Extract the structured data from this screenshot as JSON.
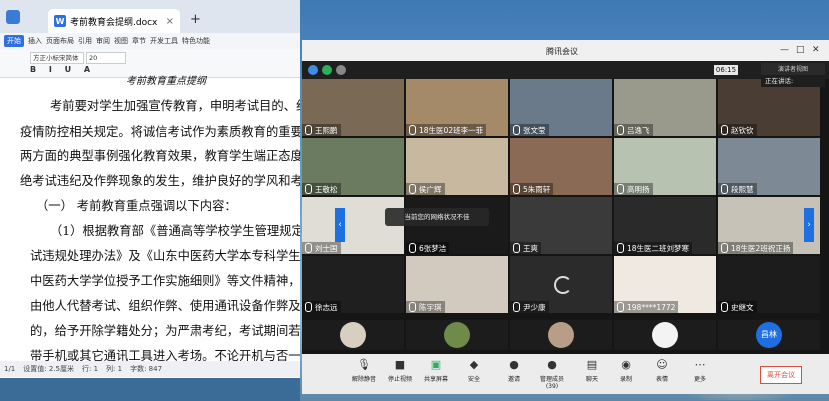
{
  "word": {
    "tab_title": "考前教育会提纲.docx",
    "doc_badge": "W",
    "plus": "+",
    "menu": [
      "开始",
      "插入",
      "页面布局",
      "引用",
      "审阅",
      "视图",
      "章节",
      "开发工具",
      "特色功能"
    ],
    "font_name": "方正小标宋简体",
    "font_size": "20",
    "format_glyphs": "B I U A",
    "lines": [
      "考前教育重点提纲",
      "考前要对学生加强宣传教育，申明考试目的、纪律和",
      "疫情防控相关规定。将诚信考试作为素质教育的重要内容",
      "两方面的典型事例强化教育效果，教育学生端正态度，诚",
      "绝考试违纪及作弊现象的发生，维护良好的学风和考风。",
      "（一） 考前教育重点强调以下内容：",
      "（1）根据教育部《普通高等学校学生管理规定》",
      "试违规处理办法》及《山东中医药大学本专科学生管理规",
      "中医药大学学位授予工作实施细则》等文件精神，对替他",
      "由他人代替考试、组织作弊、使用通讯设备作弊及其它作",
      "的，给予开除学籍处分；为严肃考纪，考试期间若发现",
      "带手机或其它通讯工具进入考场。不论开机与否一律按照"
    ],
    "status": [
      "1/1",
      "设置值: 2.5厘米",
      "行: 1",
      "列: 1",
      "字数: 847"
    ]
  },
  "meeting": {
    "title": "腾讯会议",
    "time": "06:15",
    "speaker_view": "演讲者视图",
    "speaking": "正在讲话:",
    "network_toast": "当前您的网络状况不佳",
    "participants": [
      {
        "name": "王熙鹏"
      },
      {
        "name": "18生医02班李一菲"
      },
      {
        "name": "张文莹"
      },
      {
        "name": "吕逸飞"
      },
      {
        "name": "赵钦钦"
      },
      {
        "name": "王敬松"
      },
      {
        "name": "侯广辉"
      },
      {
        "name": "5朱雨轩"
      },
      {
        "name": "高明扬"
      },
      {
        "name": "段熙慧"
      },
      {
        "name": "刘士国"
      },
      {
        "name": "6张梦洁"
      },
      {
        "name": "王爽"
      },
      {
        "name": "18生医二班刘梦寒"
      },
      {
        "name": "18生医2班祝正扬"
      },
      {
        "name": "徐志远"
      },
      {
        "name": "陈宇琪"
      },
      {
        "name": "尹少康"
      },
      {
        "name": "198****1772"
      },
      {
        "name": "史继文"
      }
    ],
    "mini_last_label": "昌林",
    "footer": [
      "解除静音",
      "停止视频",
      "共享屏幕",
      "安全",
      "邀请",
      "管理成员(39)",
      "聊天",
      "录制",
      "表情",
      "更多"
    ],
    "leave": "离开会议",
    "colors": {
      "accent": "#1e6fe0",
      "leave": "#e24c3c"
    }
  }
}
